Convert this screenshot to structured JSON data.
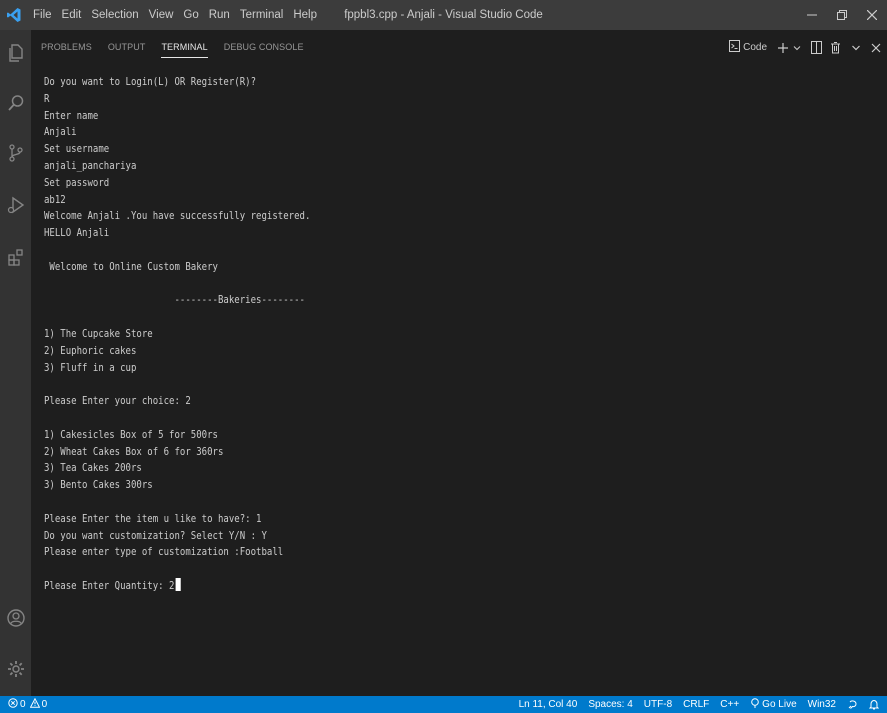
{
  "window": {
    "title": "fppbl3.cpp - Anjali - Visual Studio Code",
    "logo_icon": "vscode-logo-icon",
    "menu": [
      "File",
      "Edit",
      "Selection",
      "View",
      "Go",
      "Run",
      "Terminal",
      "Help"
    ],
    "controls": [
      "minimize-icon",
      "restore-icon",
      "close-icon"
    ]
  },
  "activity_bar": {
    "top_icons": [
      "explorer-icon",
      "search-icon",
      "source-control-icon",
      "run-debug-icon",
      "extensions-icon"
    ],
    "bottom_icons": [
      "accounts-icon",
      "manage-gear-icon"
    ]
  },
  "panel": {
    "tabs": [
      {
        "label": "PROBLEMS",
        "active": false
      },
      {
        "label": "OUTPUT",
        "active": false
      },
      {
        "label": "TERMINAL",
        "active": true
      },
      {
        "label": "DEBUG CONSOLE",
        "active": false
      }
    ],
    "actions": {
      "shell_label": "Code",
      "icons": [
        "terminal-icon",
        "new-terminal-plus-icon",
        "chevron-down-icon",
        "split-terminal-icon",
        "trash-icon",
        "chevron-down-icon",
        "close-icon"
      ]
    }
  },
  "terminal": {
    "lines": [
      "Do you want to Login(L) OR Register(R)?",
      "R",
      "Enter name",
      "Anjali",
      "Set username",
      "anjali_panchariya",
      "Set password",
      "ab12",
      "Welcome Anjali .You have successfully registered.",
      "HELLO Anjali",
      "",
      " Welcome to Online Custom Bakery",
      "",
      "                        --------Bakeries--------",
      "",
      "1) The Cupcake Store",
      "2) Euphoric cakes",
      "3) Fluff in a cup",
      "",
      "Please Enter your choice: 2",
      "",
      "1) Cakesicles Box of 5 for 500rs",
      "2) Wheat Cakes Box of 6 for 360rs",
      "3) Tea Cakes 200rs",
      "3) Bento Cakes 300rs",
      "",
      "Please Enter the item u like to have?: 1",
      "Do you want customization? Select Y/N : Y",
      "Please enter type of customization :Football",
      "",
      "Please Enter Quantity: 2"
    ]
  },
  "status_bar": {
    "errors": "0",
    "warnings": "0",
    "position": "Ln 11, Col 40",
    "spaces": "Spaces: 4",
    "encoding": "UTF-8",
    "eol": "CRLF",
    "language": "C++",
    "go_live": "Go Live",
    "platform": "Win32",
    "colors": {
      "background": "#007acc",
      "text": "#ffffff"
    }
  }
}
